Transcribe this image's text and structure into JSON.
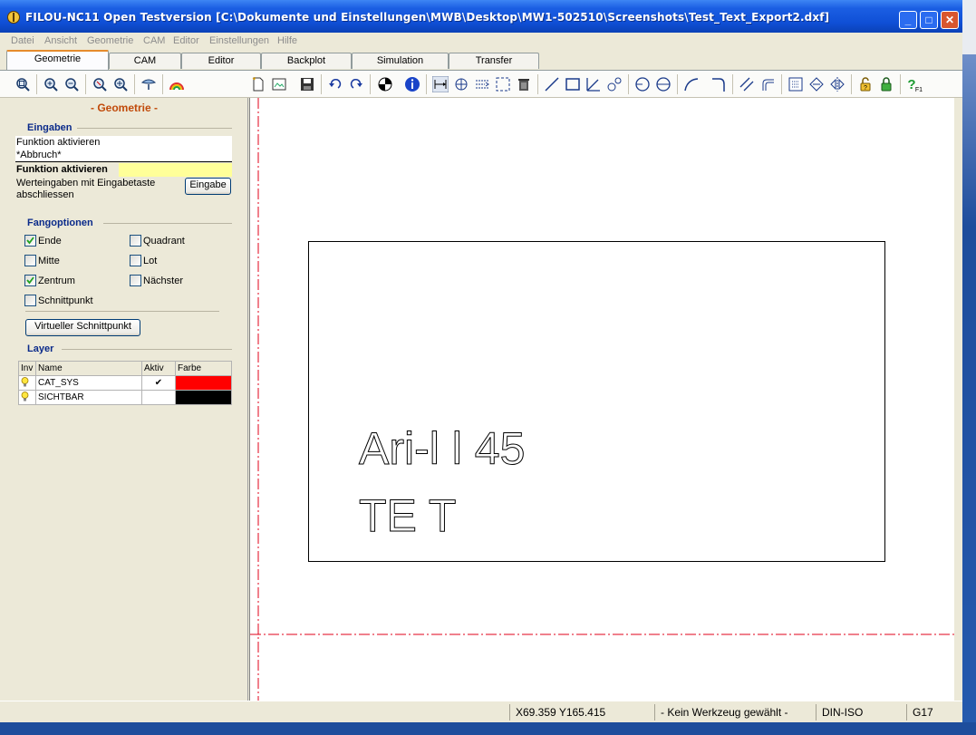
{
  "window": {
    "title": "FILOU-NC11 Open Testversion  [C:\\Dokumente und Einstellungen\\MWB\\Desktop\\MW1-502510\\Screenshots\\Test_Text_Export2.dxf]",
    "minimize_label": "_",
    "maximize_label": "□",
    "close_label": "✕"
  },
  "menu": [
    "Datei",
    "Ansicht",
    "Geometrie",
    "CAM",
    "Editor",
    "Einstellungen",
    "Hilfe"
  ],
  "tabs": [
    {
      "label": "Geometrie",
      "active": true
    },
    {
      "label": "CAM",
      "active": false
    },
    {
      "label": "Editor",
      "active": false
    },
    {
      "label": "Backplot",
      "active": false
    },
    {
      "label": "Simulation",
      "active": false
    },
    {
      "label": "Transfer",
      "active": false
    }
  ],
  "toolbar_icons": [
    "zoom-fit-icon",
    "zoom-in-icon",
    "zoom-out-icon",
    "zoom-window-icon",
    "zoom-pan-icon",
    "view-icon",
    "rainbow-icon",
    "new-file-icon",
    "open-file-icon",
    "save-icon",
    "undo-icon",
    "redo-icon",
    "center-icon",
    "info-icon",
    "distance-icon",
    "measure-icon",
    "trim-icon",
    "select-icon",
    "delete-icon",
    "line-icon",
    "rectangle-icon",
    "angle-icon",
    "point-icon",
    "circle-icon",
    "circle-2-icon",
    "arc-icon",
    "fillet-icon",
    "parallel-icon",
    "corner-icon",
    "layer-icon",
    "transform-icon",
    "mirror-icon",
    "lock-open-icon",
    "lock-icon",
    "help-icon"
  ],
  "panel": {
    "title": "- Geometrie -",
    "eingaben": {
      "heading": "Eingaben",
      "line1": "Funktion aktivieren",
      "line2": "*Abbruch*",
      "active_label": "Funktion aktivieren",
      "hint_line1": "Werteingaben mit Eingabetaste",
      "hint_line2": "abschliessen",
      "button": "Eingabe"
    },
    "fang": {
      "heading": "Fangoptionen",
      "options": [
        {
          "label": "Ende",
          "checked": true
        },
        {
          "label": "Quadrant",
          "checked": false
        },
        {
          "label": "Mitte",
          "checked": false
        },
        {
          "label": "Lot",
          "checked": false
        },
        {
          "label": "Zentrum",
          "checked": true
        },
        {
          "label": "Nächster",
          "checked": false
        },
        {
          "label": "Schnittpunkt",
          "checked": false
        }
      ],
      "virtual_button": "Virtueller Schnittpunkt"
    },
    "layer": {
      "heading": "Layer",
      "columns": [
        "Inv",
        "Name",
        "Aktiv",
        "Farbe"
      ],
      "rows": [
        {
          "name": "CAT_SYS",
          "active": "✔",
          "color": "#ff0000"
        },
        {
          "name": "SICHTBAR",
          "active": "",
          "color": "#000000"
        }
      ]
    }
  },
  "canvas": {
    "text_line1": "Ari-l l 45",
    "text_line2": "TE T",
    "axis_color": "#e0001a"
  },
  "status": {
    "coords": "X69.359 Y165.415",
    "tool": "- Kein Werkzeug gewählt -",
    "format": "DIN-ISO",
    "code": "G17"
  }
}
